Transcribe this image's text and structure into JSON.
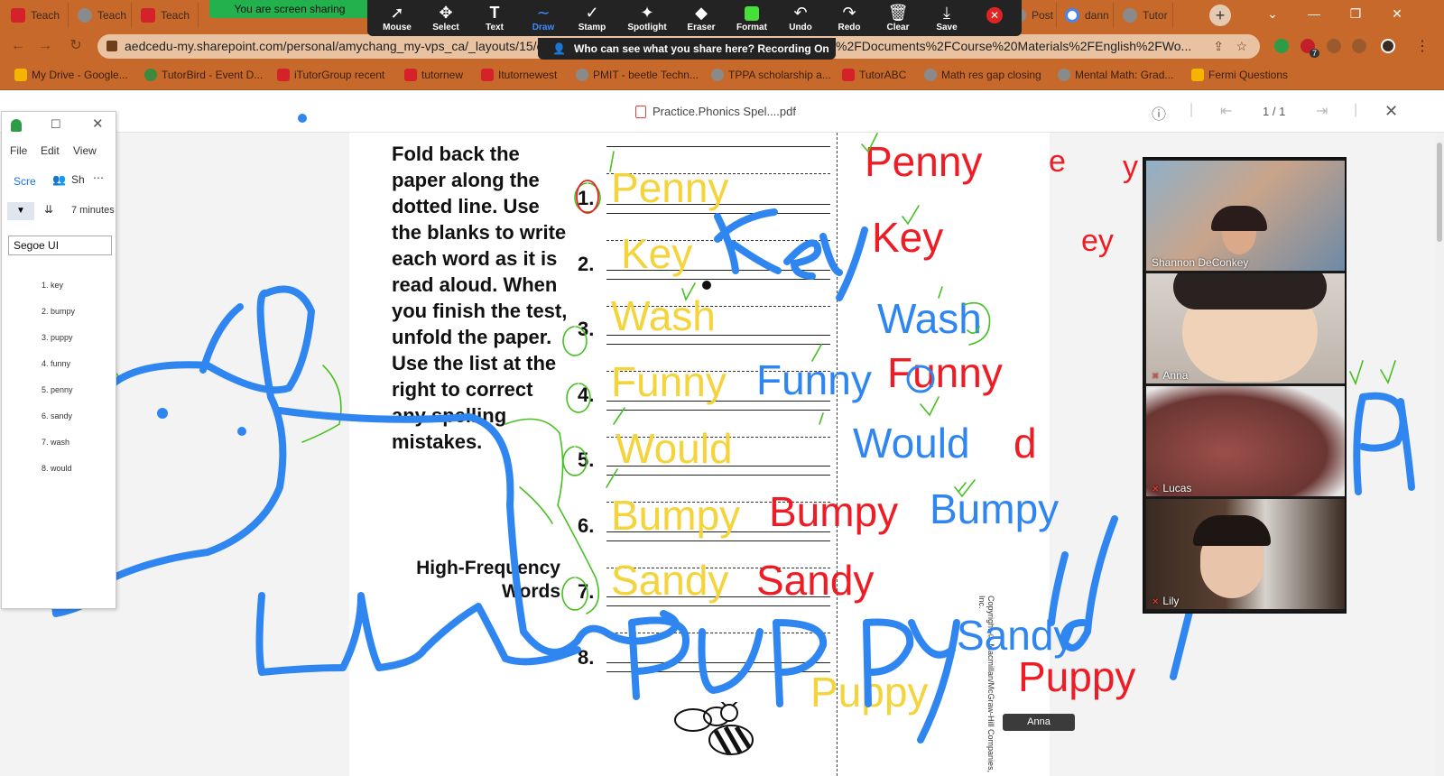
{
  "browser": {
    "tabs": [
      {
        "label": "Teach",
        "favicon": "itutor-icon"
      },
      {
        "label": "Teach",
        "favicon": "globe-icon"
      },
      {
        "label": "Teach",
        "favicon": "itutor-icon"
      },
      {
        "label": "Post",
        "favicon": "globe-icon"
      },
      {
        "label": "dann",
        "favicon": "google-icon"
      },
      {
        "label": "Tutor",
        "favicon": "globe-icon"
      }
    ],
    "url": "aedcedu-my.sharepoint.com/personal/amychang_my-vps_ca/_layouts/15/o",
    "url_tail": "%2FDocuments%2FCourse%20Materials%2FEnglish%2FWo...",
    "bookmarks": [
      "My Drive - Google...",
      "TutorBird - Event D...",
      "iTutorGroup recent",
      "tutornew",
      "Itutornewest",
      "PMIT - beetle Techn...",
      "TPPA scholarship a...",
      "TutorABC",
      "Math res gap closing",
      "Mental Math: Grad...",
      "Fermi Questions"
    ],
    "extension_badge": "7"
  },
  "zoom": {
    "sharing_pill": "You are screen sharing",
    "tools": [
      "Mouse",
      "Select",
      "Text",
      "Draw",
      "Stamp",
      "Spotlight",
      "Eraser",
      "Format",
      "Undo",
      "Redo",
      "Clear",
      "Save"
    ],
    "active_tool": "Draw",
    "notice": "Who can see what you share here? Recording On"
  },
  "pdf": {
    "title": "Practice.Phonics Spel....pdf",
    "page_indicator": "1 / 1",
    "instructions": "Fold back the paper along the dotted line. Use the blanks to write each word as it is read aloud. When you finish the test, unfold the paper. Use the list at the right to correct any spelling mistakes.",
    "section_title_line1": "High-Frequency",
    "section_title_line2": "Words",
    "numbers": [
      "1.",
      "2.",
      "3.",
      "4.",
      "5.",
      "6.",
      "7.",
      "8."
    ],
    "copyright": "Copyright © Macmillan/McGraw-Hill Companies, Inc."
  },
  "annotations": {
    "yellow": [
      "Penny",
      "Key",
      "Wash",
      "Funny",
      "Would",
      "Bumpy",
      "Sandy",
      "Puppy"
    ],
    "red": [
      "Penny",
      "Key",
      "Funny",
      "d",
      "Bumpy",
      "Sandy",
      "Puppy",
      "e",
      "y",
      "ey"
    ],
    "blue": [
      "Key",
      "Funny",
      "Wash",
      "Would",
      "Bumpy",
      "Sandy",
      "Puppy",
      "A"
    ]
  },
  "side_app": {
    "menu": [
      "File",
      "Edit",
      "View"
    ],
    "tab_label": "Scre",
    "share_label": "Sh",
    "duration": "7 minutes",
    "font_value": "Segoe UI",
    "words": [
      "1. key",
      "2. bumpy",
      "3. puppy",
      "4. funny",
      "5. penny",
      "6. sandy",
      "7. wash",
      "8. would"
    ]
  },
  "participants": [
    {
      "name": "Shannon DeConkey",
      "muted": false
    },
    {
      "name": "Anna",
      "muted": true
    },
    {
      "name": "Lucas",
      "muted": true
    },
    {
      "name": "Lily",
      "muted": true
    }
  ],
  "active_speaker_label": "Anna",
  "colors": {
    "chrome": "#c8692c",
    "annotation_yellow": "#f5d33a",
    "annotation_red": "#ee1c24",
    "annotation_blue": "#2f86f0",
    "annotation_green": "#46c021",
    "zoom_toolbar": "#232323"
  }
}
